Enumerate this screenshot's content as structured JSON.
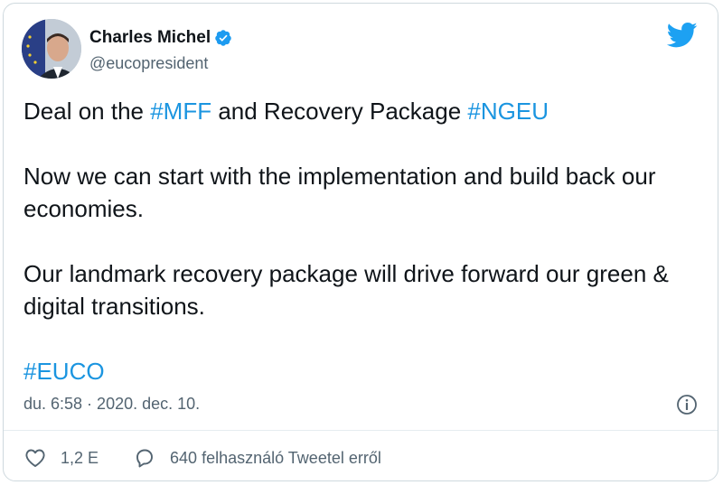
{
  "author": {
    "name": "Charles Michel",
    "handle": "@eucopresident",
    "verified": true
  },
  "tweet": {
    "lines": [
      {
        "text_1": "Deal on the ",
        "tag_1": "#MFF",
        "text_2": " and Recovery Package ",
        "tag_2": "#NGEU"
      },
      {
        "text": "Now we can start with the implementation and build back our economies."
      },
      {
        "text": "Our landmark recovery package will drive forward our green & digital transitions."
      },
      {
        "tag": "#EUCO"
      }
    ],
    "timestamp": "du. 6:58 · 2020. dec. 10."
  },
  "actions": {
    "like_count": "1,2 E",
    "reply_label": "640 felhasználó Tweetel erről"
  },
  "colors": {
    "accent": "#1b95e0",
    "text": "#0f1419",
    "muted": "#536471"
  },
  "icons": [
    "verified-badge-icon",
    "twitter-bird-icon",
    "info-icon",
    "heart-icon",
    "comment-icon"
  ]
}
